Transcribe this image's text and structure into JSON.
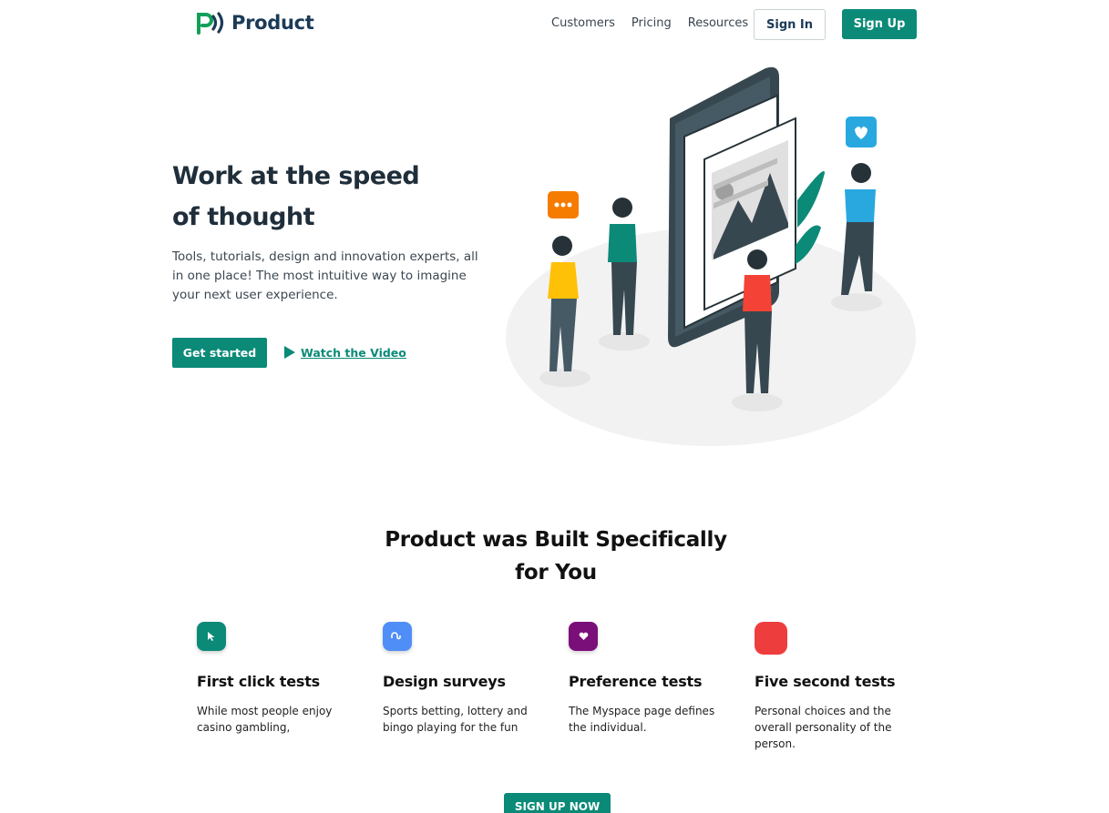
{
  "nav": {
    "brand": "Product",
    "links": [
      "Customers",
      "Pricing",
      "Resources"
    ],
    "sign_in": "Sign In",
    "sign_up": "Sign Up"
  },
  "hero": {
    "title_line1": "Work at the speed",
    "title_line2": "of thought",
    "description": "Tools, tutorials, design and innovation experts, all in one place! The most intuitive way to imagine your next user experience.",
    "cta_primary": "Get started",
    "cta_secondary": "Watch the Video"
  },
  "features_section": {
    "title_line1": "Product was Built Specifically",
    "title_line2": "for You",
    "items": [
      {
        "title": "First click tests",
        "description": "While most people enjoy casino gambling,",
        "icon": "cursor-icon",
        "color": "#0b8a78"
      },
      {
        "title": "Design surveys",
        "description": "Sports betting, lottery and bingo playing for the fun",
        "icon": "stumbleupon-icon",
        "color": "#4f8ef7"
      },
      {
        "title": "Preference tests",
        "description": "The Myspace page defines the individual.",
        "icon": "heart-icon",
        "color": "#7a0f7a"
      },
      {
        "title": "Five second tests",
        "description": "Personal choices and the overall personality of the person.",
        "icon": "blank-icon",
        "color": "#ee3d3d"
      }
    ],
    "cta": "SIGN UP NOW"
  },
  "colors": {
    "accent": "#0b8a78",
    "brand_text": "#1b3a57"
  }
}
